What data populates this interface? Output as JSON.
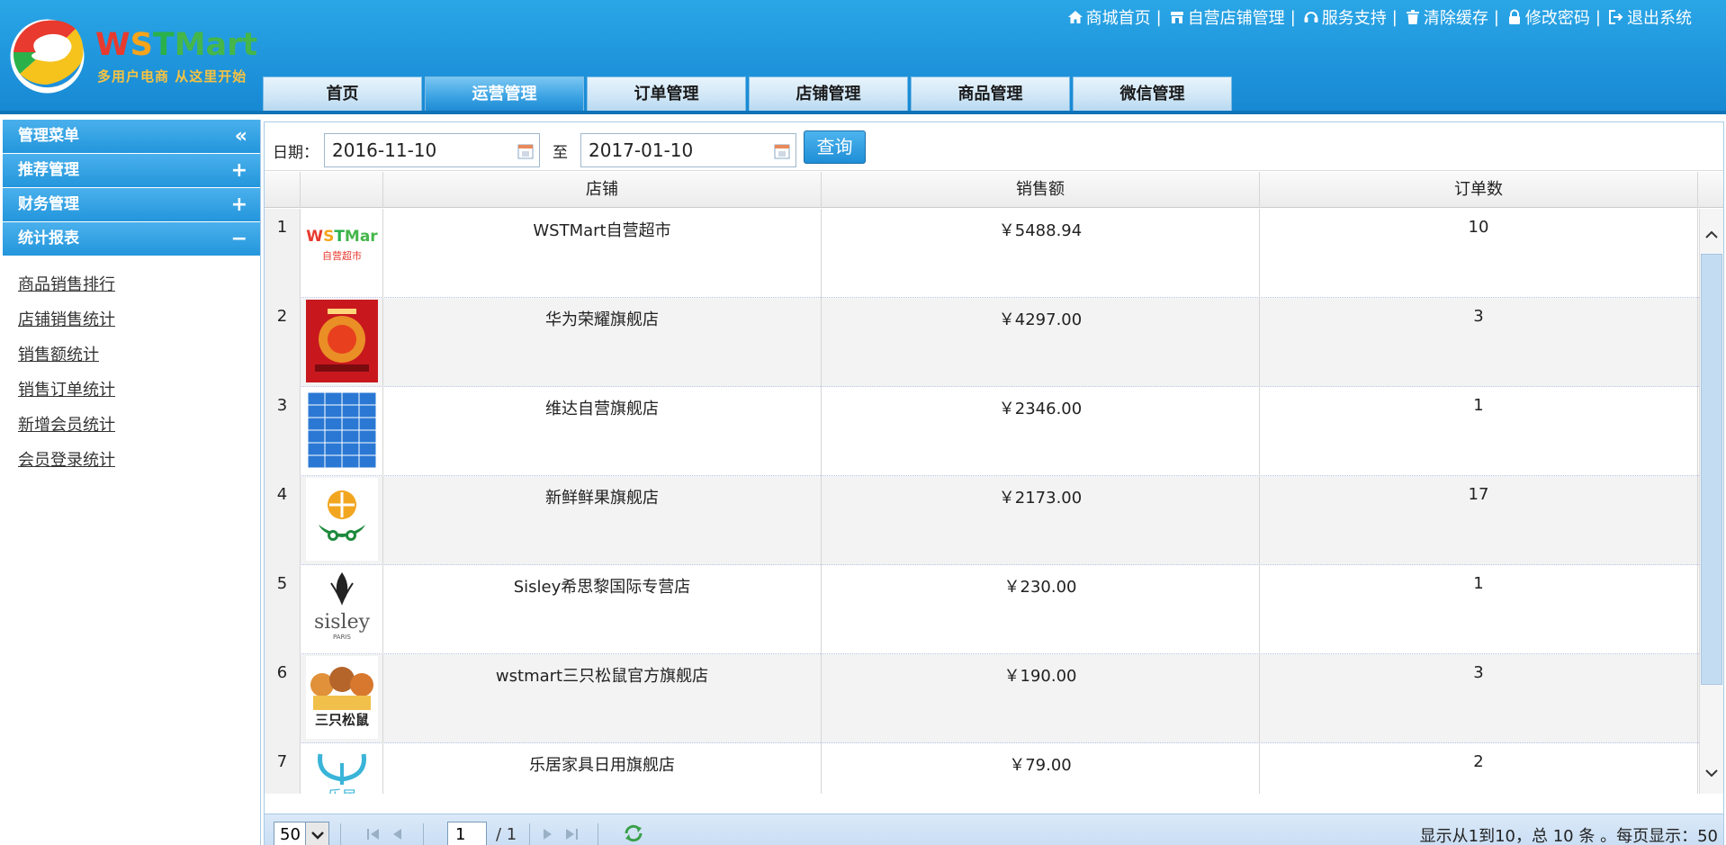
{
  "logo": {
    "brand_w": "W",
    "brand_s": "S",
    "brand_t": "T",
    "brand_mart": "Mart",
    "slogan": "多用户电商 从这里开始"
  },
  "top_links": [
    {
      "label": "商城首页",
      "sep": "|",
      "icon": "home-icon"
    },
    {
      "label": "自营店铺管理",
      "sep": "|",
      "icon": "store-icon"
    },
    {
      "label": "服务支持",
      "sep": "|",
      "icon": "headset-icon"
    },
    {
      "label": "清除缓存",
      "sep": "|",
      "icon": "trash-icon"
    },
    {
      "label": "修改密码",
      "sep": "|",
      "icon": "lock-icon"
    },
    {
      "label": "退出系统",
      "sep": "",
      "icon": "logout-icon"
    }
  ],
  "nav_tabs": [
    {
      "label": "首页",
      "active": false
    },
    {
      "label": "运营管理",
      "active": true
    },
    {
      "label": "订单管理",
      "active": false
    },
    {
      "label": "店铺管理",
      "active": false
    },
    {
      "label": "商品管理",
      "active": false
    },
    {
      "label": "微信管理",
      "active": false
    }
  ],
  "sidebar": {
    "title": "管理菜单",
    "title_toggle": "«",
    "groups": [
      {
        "label": "推荐管理",
        "toggle": "+"
      },
      {
        "label": "财务管理",
        "toggle": "+"
      },
      {
        "label": "统计报表",
        "toggle": "−"
      }
    ],
    "links": [
      "商品销售排行",
      "店铺销售统计",
      "销售额统计",
      "销售订单统计",
      "新增会员统计",
      "会员登录统计"
    ]
  },
  "filter": {
    "date_label": "日期：",
    "start_date": "2016-11-10",
    "sep": "至",
    "end_date": "2017-01-10",
    "query_button": "查询"
  },
  "table": {
    "columns": [
      "店铺",
      "销售额",
      "订单数"
    ],
    "rows": [
      {
        "no": "1",
        "shop": "WSTMart自营超市",
        "sales": "￥5488.94",
        "orders": "10",
        "logo": "wstmart-logo-icon",
        "logo_text": "WSTMart",
        "logo_sub": "自营超市"
      },
      {
        "no": "2",
        "shop": "华为荣耀旗舰店",
        "sales": "￥4297.00",
        "orders": "3",
        "logo": "honor-poster-icon"
      },
      {
        "no": "3",
        "shop": "维达自营旗舰店",
        "sales": "￥2346.00",
        "orders": "1",
        "logo": "tissue-packs-icon"
      },
      {
        "no": "4",
        "shop": "新鲜鲜果旗舰店",
        "sales": "￥2173.00",
        "orders": "17",
        "logo": "fruit-logo-icon"
      },
      {
        "no": "5",
        "shop": "Sisley希思黎国际专营店",
        "sales": "￥230.00",
        "orders": "1",
        "logo": "sisley-logo-icon",
        "logo_text": "sisley",
        "logo_sub": "PARIS"
      },
      {
        "no": "6",
        "shop": "wstmart三只松鼠官方旗舰店",
        "sales": "￥190.00",
        "orders": "3",
        "logo": "squirrels-logo-icon",
        "logo_text": "三只松鼠"
      },
      {
        "no": "7",
        "shop": "乐居家具日用旗舰店",
        "sales": "￥79.00",
        "orders": "2",
        "logo": "leju-logo-icon",
        "logo_text": "乐居"
      }
    ]
  },
  "pager": {
    "page_size": "50",
    "current_page": "1",
    "total_pages": "/ 1",
    "info": "显示从1到10，总 10 条 。每页显示：50"
  },
  "colors": {
    "header_blue": "#1f95dc",
    "active_tab": "#2396dc",
    "query_button": "#1f8ed6"
  }
}
